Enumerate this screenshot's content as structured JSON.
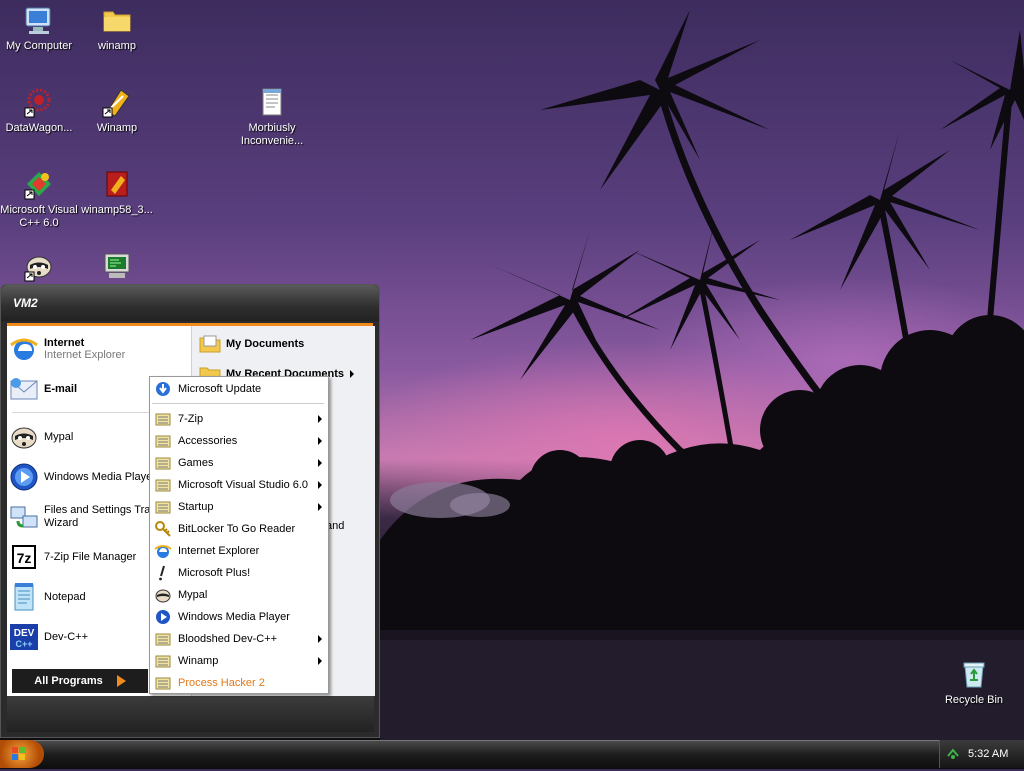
{
  "desktop": {
    "icons": [
      {
        "label": "My Computer",
        "icon": "my-computer-icon"
      },
      {
        "label": "winamp",
        "icon": "folder-icon"
      },
      {
        "label": "DataWagon...",
        "icon": "datawagon-icon"
      },
      {
        "label": "Winamp",
        "icon": "winamp-icon"
      },
      {
        "label": "Morbiusly Inconvenie...",
        "icon": "text-document-icon"
      },
      {
        "label": "Microsoft Visual C++ 6.0",
        "icon": "visual-cpp-icon"
      },
      {
        "label": "winamp58_3...",
        "icon": "winamp-installer-icon"
      },
      {
        "label": "",
        "icon": "mypal-raccoon-icon"
      },
      {
        "label": "",
        "icon": "terminal-computer-icon"
      },
      {
        "label": "Recycle Bin",
        "icon": "recycle-bin-icon"
      }
    ]
  },
  "start_menu": {
    "user": "VM2",
    "pinned": [
      {
        "title": "Internet",
        "subtitle": "Internet Explorer"
      },
      {
        "title": "E-mail",
        "subtitle": ""
      }
    ],
    "recent": [
      {
        "label": "Mypal"
      },
      {
        "label": "Windows Media Player"
      },
      {
        "label": "Files and Settings Transfer Wizard"
      },
      {
        "label": "7-Zip File Manager"
      },
      {
        "label": "Notepad"
      },
      {
        "label": "Dev-C++"
      }
    ],
    "right": [
      {
        "label": "My Documents"
      },
      {
        "label": "My Recent Documents"
      }
    ],
    "right_partial": "and",
    "all_programs": "All Programs"
  },
  "programs_menu": {
    "items": [
      {
        "label": "Microsoft Update",
        "icon": "windows-update-icon",
        "submenu": false
      },
      {
        "label": "7-Zip",
        "icon": "program-group-icon",
        "submenu": true
      },
      {
        "label": "Accessories",
        "icon": "program-group-icon",
        "submenu": true
      },
      {
        "label": "Games",
        "icon": "program-group-icon",
        "submenu": true
      },
      {
        "label": "Microsoft Visual Studio 6.0",
        "icon": "program-group-icon",
        "submenu": true
      },
      {
        "label": "Startup",
        "icon": "program-group-icon",
        "submenu": true
      },
      {
        "label": "BitLocker To Go Reader",
        "icon": "bitlocker-key-icon",
        "submenu": false
      },
      {
        "label": "Internet Explorer",
        "icon": "internet-explorer-icon",
        "submenu": false
      },
      {
        "label": "Microsoft Plus!",
        "icon": "microsoft-plus-icon",
        "submenu": false
      },
      {
        "label": "Mypal",
        "icon": "mypal-raccoon-icon",
        "submenu": false
      },
      {
        "label": "Windows Media Player",
        "icon": "media-player-icon",
        "submenu": false
      },
      {
        "label": "Bloodshed Dev-C++",
        "icon": "program-group-icon",
        "submenu": true
      },
      {
        "label": "Winamp",
        "icon": "program-group-icon",
        "submenu": true
      },
      {
        "label": "Process Hacker 2",
        "icon": "program-group-icon",
        "submenu": true
      }
    ]
  },
  "taskbar": {
    "clock": "5:32 AM"
  },
  "colors": {
    "accent": "#f08a1c",
    "highlight_text": "#e07818"
  }
}
